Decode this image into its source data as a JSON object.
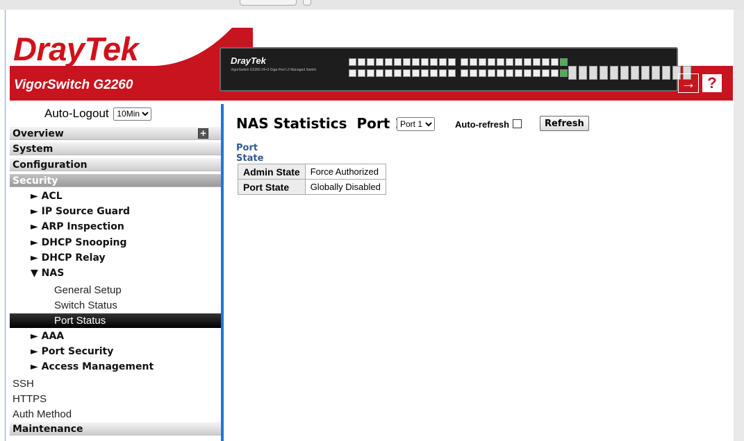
{
  "header": {
    "brand_dray": "Dray",
    "brand_tek": "Tek",
    "model": "VigorSwitch G2260",
    "panel_brand": "DrayTek",
    "panel_sub": "VigorSwitch G2260\n24+2 Giga Port L2 Managed Switch",
    "logout_icon": "logout-arrow-icon",
    "help_label": "?"
  },
  "sidebar": {
    "autologout_label": "Auto-Logout",
    "autologout_value": "10Min",
    "sections": {
      "overview": "Overview",
      "system": "System",
      "configuration": "Configuration",
      "security": "Security",
      "maintenance": "Maintenance"
    },
    "security_items": [
      "► ACL",
      "► IP Source Guard",
      "► ARP Inspection",
      "► DHCP Snooping",
      "► DHCP Relay",
      "▼ NAS"
    ],
    "nas_items": [
      "General Setup",
      "Switch Status",
      "Port Status"
    ],
    "more_items": [
      "► AAA",
      "► Port Security",
      "► Access Management"
    ],
    "plain_items": [
      "SSH",
      "HTTPS",
      "Auth Method"
    ],
    "selected": "Port Status"
  },
  "main": {
    "title": "NAS Statistics  Port 1",
    "port_select_value": "Port 1",
    "auto_refresh_label": "Auto-refresh",
    "refresh_button": "Refresh",
    "section_title": "Port State",
    "table": [
      {
        "label": "Admin State",
        "value": "Force Authorized"
      },
      {
        "label": "Port State",
        "value": "Globally Disabled"
      }
    ]
  },
  "colors": {
    "brand_red": "#c8141e",
    "link_blue": "#2d5b8f",
    "divider_blue": "#2277cc"
  }
}
